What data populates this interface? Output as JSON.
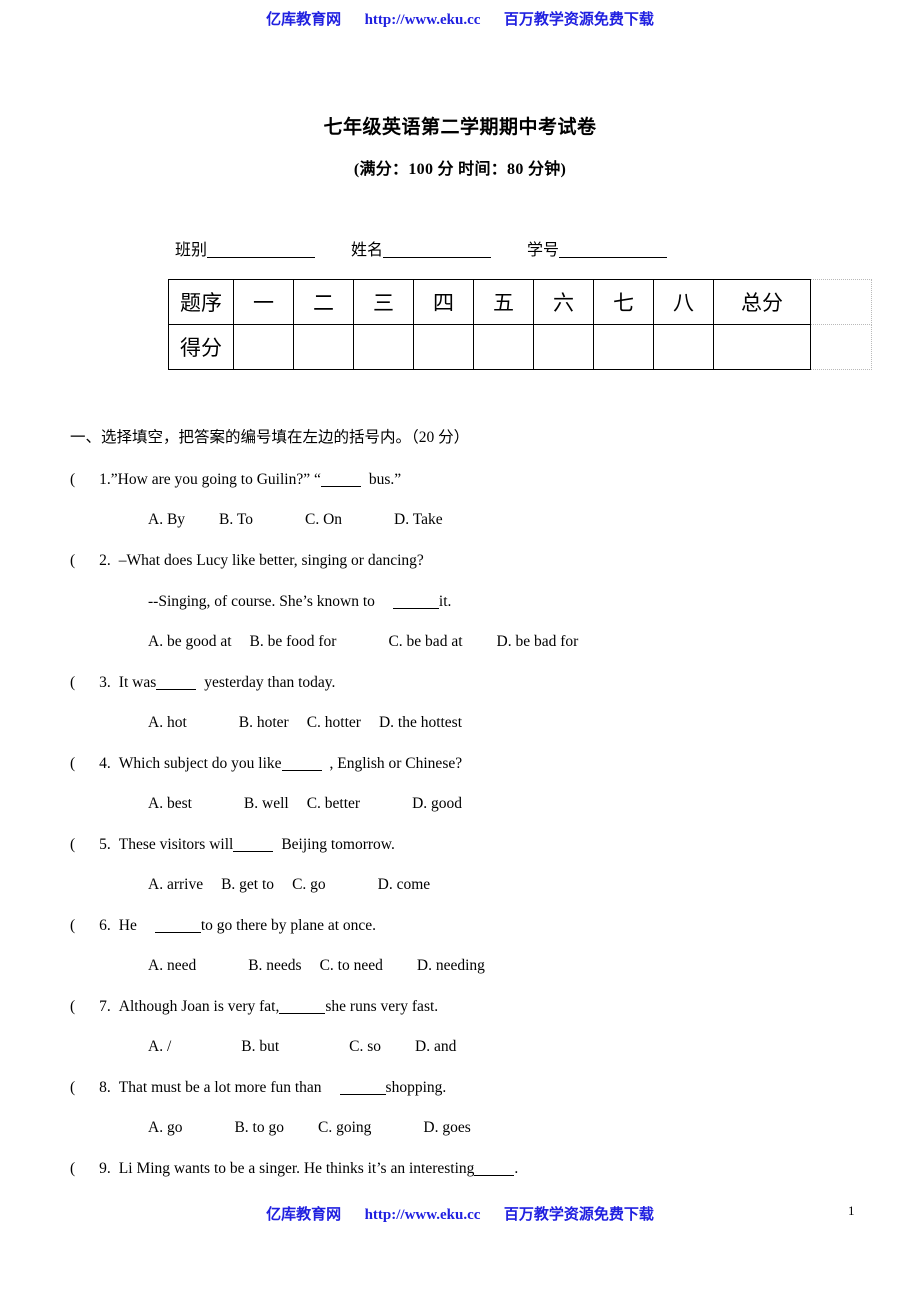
{
  "site_header": {
    "brand": "亿库教育网",
    "url": "http://www.eku.cc",
    "tagline": "百万教学资源免费下载"
  },
  "site_footer": {
    "brand": "亿库教育网",
    "url": "http://www.eku.cc",
    "tagline": "百万教学资源免费下载",
    "page_number": "1"
  },
  "document": {
    "title": "七年级英语第二学期期中考试卷",
    "subtitle": "(满分：100 分   时间：80 分钟)"
  },
  "student_info": {
    "class_label": "班别",
    "name_label": "姓名",
    "id_label": "学号"
  },
  "score_table": {
    "row_labels": [
      "题序",
      "得分"
    ],
    "columns": [
      "一",
      "二",
      "三",
      "四",
      "五",
      "六",
      "七",
      "八"
    ],
    "total_label": "总分"
  },
  "section_one": {
    "heading": "一、选择填空，把答案的编号填在左边的括号内。（20 分）",
    "questions": [
      {
        "number": "1.",
        "stem_before": "”How are you going to Guilin?” “",
        "stem_after": "bus.”",
        "options": [
          "A. By",
          "B. To",
          "C. On",
          "D. Take"
        ]
      },
      {
        "number": "2.",
        "stem_before": "–What does Lucy like better, singing or dancing?",
        "continuation_before": "--Singing, of course. She’s known to",
        "continuation_after": "it.",
        "options": [
          "A. be good at",
          "B. be food for",
          "C. be bad at",
          "D. be bad for"
        ]
      },
      {
        "number": "3.",
        "stem_before": "It was",
        "stem_after": "yesterday than today.",
        "options": [
          "A. hot",
          "B. hoter",
          "C. hotter",
          "D. the hottest"
        ]
      },
      {
        "number": "4.",
        "stem_before": "Which subject do you like",
        "stem_after": ", English or Chinese?",
        "options": [
          "A. best",
          "B. well",
          "C. better",
          "D. good"
        ]
      },
      {
        "number": "5.",
        "stem_before": "These visitors will",
        "stem_after": "Beijing tomorrow.",
        "options": [
          "A. arrive",
          "B. get to",
          "C. go",
          "D. come"
        ]
      },
      {
        "number": "6.",
        "stem_before": "He",
        "stem_after": "to go there by plane at once.",
        "options": [
          "A. need",
          "B. needs",
          "C. to need",
          "D. needing"
        ]
      },
      {
        "number": "7.",
        "stem_before": "Although Joan is very fat,",
        "stem_after": "she runs very fast.",
        "options": [
          "A. /",
          "B. but",
          "C. so",
          "D. and"
        ]
      },
      {
        "number": "8.",
        "stem_before": "That must be a lot more fun than",
        "stem_after": "shopping.",
        "options": [
          "A. go",
          "B. to go",
          "C. going",
          "D. goes"
        ]
      },
      {
        "number": "9.",
        "stem_before": "Li Ming wants to be a singer. He thinks it’s an interesting",
        "stem_after": ".",
        "options": []
      }
    ]
  }
}
